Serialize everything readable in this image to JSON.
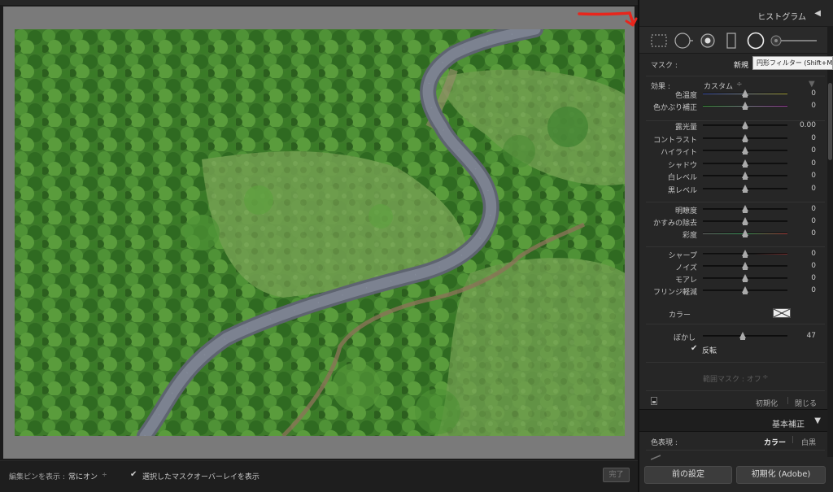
{
  "toolbar": {
    "pin_label": "編集ピンを表示 :",
    "pin_value": "常にオン",
    "pin_chevron": "÷",
    "overlay_check": "✔",
    "overlay_label": "選択したマスクオーバーレイを表示",
    "done_label": "完了"
  },
  "panel": {
    "histogram_title": "ヒストグラム",
    "histogram_toggle": "◀",
    "mask_label": "マスク :",
    "mask_new": "新規",
    "tooltip": "円形フィルター (Shift+M)",
    "effect_label": "効果 :",
    "effect_value": "カスタム",
    "effect_chevron": "÷",
    "effect_tri": "▼",
    "sliders": [
      {
        "label": "色温度",
        "value": "0",
        "pos": 0.5,
        "track": "temp"
      },
      {
        "label": "色かぶり補正",
        "value": "0",
        "pos": 0.5,
        "track": "tint"
      },
      {
        "label": "露光量",
        "value": "0.00",
        "pos": 0.5,
        "track": "plain"
      },
      {
        "label": "コントラスト",
        "value": "0",
        "pos": 0.5,
        "track": "plain"
      },
      {
        "label": "ハイライト",
        "value": "0",
        "pos": 0.5,
        "track": "plain"
      },
      {
        "label": "シャドウ",
        "value": "0",
        "pos": 0.5,
        "track": "plain"
      },
      {
        "label": "白レベル",
        "value": "0",
        "pos": 0.5,
        "track": "plain"
      },
      {
        "label": "黒レベル",
        "value": "0",
        "pos": 0.5,
        "track": "plain"
      },
      {
        "label": "明瞭度",
        "value": "0",
        "pos": 0.5,
        "track": "plain"
      },
      {
        "label": "かすみの除去",
        "value": "0",
        "pos": 0.5,
        "track": "plain"
      },
      {
        "label": "彩度",
        "value": "0",
        "pos": 0.5,
        "track": "sat"
      },
      {
        "label": "シャープ",
        "value": "0",
        "pos": 0.5,
        "track": "sharp"
      },
      {
        "label": "ノイズ",
        "value": "0",
        "pos": 0.5,
        "track": "plain"
      },
      {
        "label": "モアレ",
        "value": "0",
        "pos": 0.5,
        "track": "plain"
      },
      {
        "label": "フリンジ軽減",
        "value": "0",
        "pos": 0.5,
        "track": "plain"
      }
    ],
    "color_label": "カラー",
    "blur_label": "ぼかし",
    "blur_value": "47",
    "blur_pos": 0.47,
    "invert_check": "✔",
    "invert_label": "反転",
    "range_mask_label": "範囲マスク : オフ",
    "range_mask_chevron": "÷",
    "reset_label": "初期化",
    "close_label": "閉じる",
    "basic_title": "基本補正",
    "basic_toggle": "▼",
    "treatment_label": "色表現 :",
    "treatment_color": "カラー",
    "treatment_bw": "白黒",
    "prev_button": "前の設定",
    "reset_adobe_button": "初期化 (Adobe)"
  },
  "colors": {
    "annotation_arrow": "#e8261c",
    "panel_bg": "#262626",
    "canvas_bg": "#7a7a7a"
  }
}
